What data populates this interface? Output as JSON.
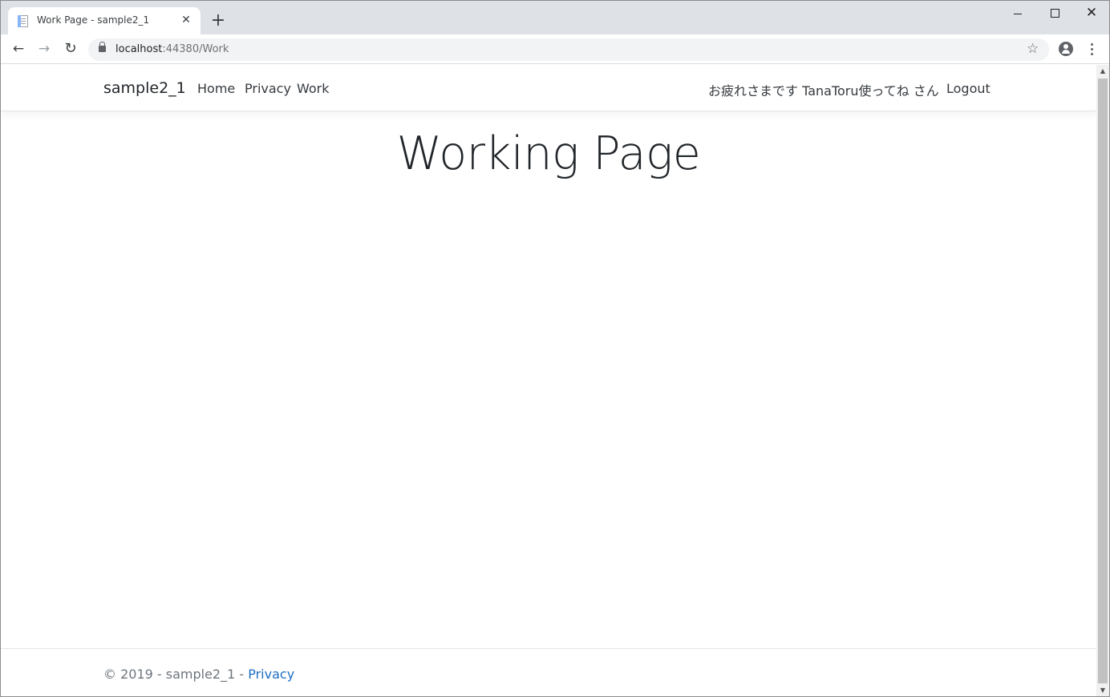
{
  "browser": {
    "tab_title": "Work Page - sample2_1",
    "tab_close": "✕",
    "new_tab": "+",
    "url_host": "localhost",
    "url_path": ":44380/Work",
    "window_close": "✕"
  },
  "page": {
    "brand": "sample2_1",
    "nav": {
      "home": "Home",
      "privacy": "Privacy",
      "work": "Work"
    },
    "greeting": "お疲れさまです TanaToru使ってね さん",
    "logout": "Logout",
    "heading": "Working Page",
    "footer": {
      "text": "© 2019 - sample2_1 - ",
      "link": "Privacy"
    }
  },
  "colors": {
    "link": "#1b6ec2",
    "tabstrip": "#dee1e6"
  }
}
